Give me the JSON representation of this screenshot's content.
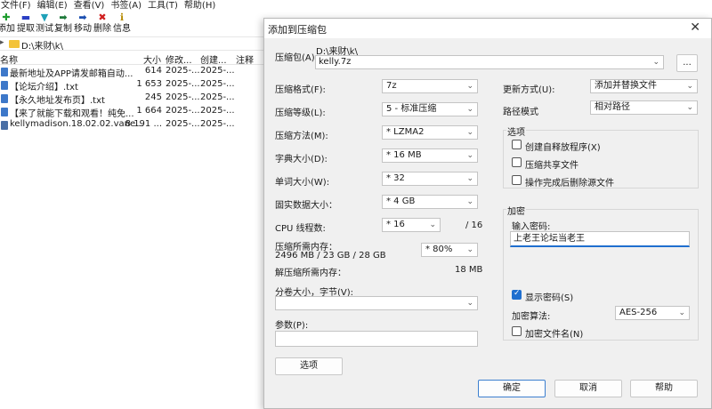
{
  "menu": [
    "文件(F)",
    "编辑(E)",
    "查看(V)",
    "书签(A)",
    "工具(T)",
    "帮助(H)"
  ],
  "toolbar": {
    "add": "添加",
    "extract": "提取",
    "test": "测试",
    "copy": "复制",
    "move": "移动",
    "delete": "删除",
    "info": "信息"
  },
  "path": "D:\\来财\\k\\",
  "list": {
    "headers": {
      "name": "名称",
      "size": "大小",
      "modified": "修改...",
      "created": "创建...",
      "comment": "注释"
    },
    "rows": [
      {
        "name": "最新地址及APP请发邮箱自动...",
        "size": "614",
        "modified": "2025-...",
        "created": "2025-..."
      },
      {
        "name": "【论坛介绍】.txt",
        "size": "1 653",
        "modified": "2025-...",
        "created": "2025-..."
      },
      {
        "name": "【永久地址发布页】.txt",
        "size": "245",
        "modified": "2025-...",
        "created": "2025-..."
      },
      {
        "name": "【来了就能下载和观看！纯免...",
        "size": "1 664",
        "modified": "2025-...",
        "created": "2025-..."
      },
      {
        "name": "kellymadison.18.02.02.vane...",
        "size": "8 191 ...",
        "modified": "2025-...",
        "created": "2025-..."
      }
    ]
  },
  "dialog": {
    "title": "添加到压缩包",
    "archive_label": "压缩包(A):",
    "archive_dir": "D:\\来财\\k\\",
    "archive_name": "kelly.7z",
    "browse": "...",
    "format_label": "压缩格式(F):",
    "format_value": "7z",
    "level_label": "压缩等级(L):",
    "level_value": "5 - 标准压缩",
    "method_label": "压缩方法(M):",
    "method_value": "* LZMA2",
    "dict_label": "字典大小(D):",
    "dict_value": "* 16 MB",
    "word_label": "单词大小(W):",
    "word_value": "* 32",
    "solid_label": "固实数据大小：",
    "solid_value": "* 4 GB",
    "threads_label": "CPU 线程数:",
    "threads_value": "* 16",
    "threads_max": "/ 16",
    "mem_comp_label": "压缩所需内存：",
    "mem_comp_value": "2496 MB / 23 GB / 28 GB",
    "mem_pct": "* 80%",
    "mem_decomp_label": "解压缩所需内存：",
    "mem_decomp_value": "18 MB",
    "split_label": "分卷大小，字节(V):",
    "params_label": "参数(P):",
    "options_btn": "选项",
    "update_label": "更新方式(U):",
    "update_value": "添加并替换文件",
    "pathmode_label": "路径模式",
    "pathmode_value": "相对路径",
    "options_group": "选项",
    "opt_sfx": "创建自释放程序(X)",
    "opt_shared": "压缩共享文件",
    "opt_delete": "操作完成后删除源文件",
    "encrypt_group": "加密",
    "password_label": "输入密码:",
    "password_value": "上老王论坛当老王",
    "show_password": "显示密码(S)",
    "enc_method_label": "加密算法:",
    "enc_method_value": "AES-256",
    "encrypt_names": "加密文件名(N)",
    "ok": "确定",
    "cancel": "取消",
    "help": "帮助"
  }
}
